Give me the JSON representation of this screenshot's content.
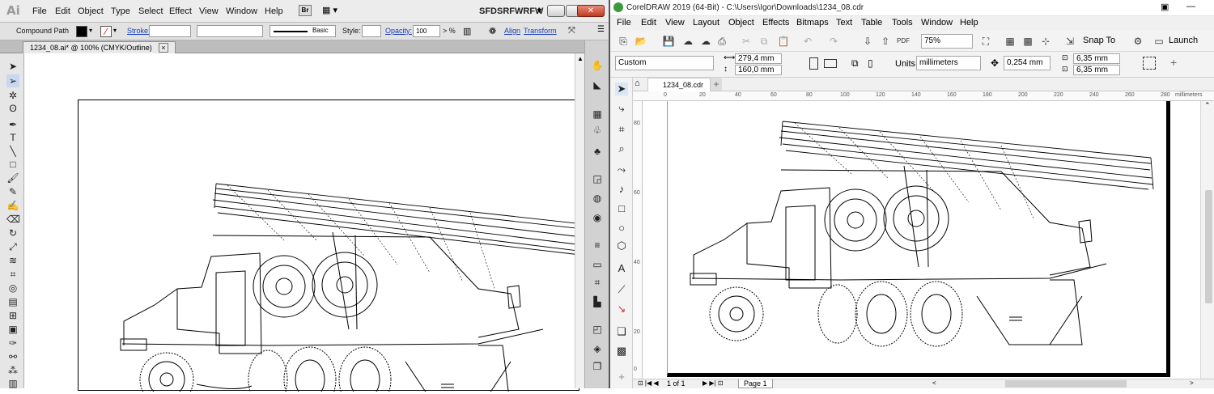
{
  "illustrator": {
    "logo": "Ai",
    "menu": [
      "File",
      "Edit",
      "Object",
      "Type",
      "Select",
      "Effect",
      "View",
      "Window",
      "Help"
    ],
    "bridge_label": "Br",
    "workspace": "SFDSRFWRFW",
    "control": {
      "selection": "Compound Path",
      "stroke_label": "Stroke:",
      "brush_label": "Basic",
      "style_label": "Style:",
      "opacity_label": "Opacity:",
      "opacity_value": "100",
      "opacity_unit": "> %",
      "align_label": "Align",
      "transform_label": "Transform"
    },
    "doc_tab": "1234_08.ai* @ 100% (CMYK/Outline)",
    "doc_tab_close": "×"
  },
  "coreldraw": {
    "title": "CorelDRAW 2019 (64-Bit) - C:\\Users\\Igor\\Downloads\\1234_08.cdr",
    "menu": [
      "File",
      "Edit",
      "View",
      "Layout",
      "Object",
      "Effects",
      "Bitmaps",
      "Text",
      "Table",
      "Tools",
      "Window",
      "Help"
    ],
    "zoom": "75%",
    "snap_label": "Snap To",
    "launch_label": "Launch",
    "page_preset": "Custom",
    "page_width": "279,4 mm",
    "page_height": "160,0 mm",
    "units_label": "Units:",
    "units_value": "millimeters",
    "nudge": "0,254 mm",
    "dup_x": "6,35 mm",
    "dup_y": "6,35 mm",
    "doc_tab": "1234_08.cdr",
    "ruler_h": [
      "0",
      "20",
      "40",
      "60",
      "80",
      "100",
      "120",
      "140",
      "160",
      "180",
      "200",
      "220",
      "240",
      "260",
      "280"
    ],
    "ruler_unit": "millimeters",
    "ruler_v": [
      "80",
      "60",
      "40",
      "20",
      "0"
    ],
    "status_pages": "1 of 1",
    "status_page_tab": "Page 1"
  }
}
